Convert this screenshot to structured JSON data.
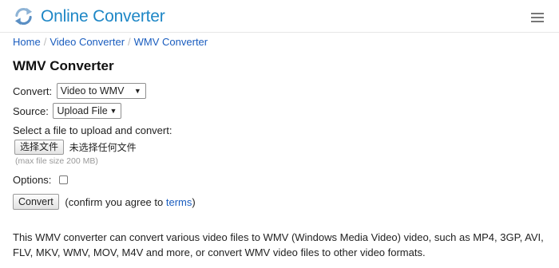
{
  "header": {
    "brand": "Online Converter",
    "logo_icon": "refresh-arrows-icon",
    "menu_icon": "hamburger-menu-icon",
    "brand_color": "#1e87c6"
  },
  "breadcrumb": {
    "items": [
      "Home",
      "Video Converter",
      "WMV Converter"
    ],
    "separator": "/"
  },
  "page_title": "WMV Converter",
  "form": {
    "convert_label": "Convert:",
    "convert_value": "Video to WMV",
    "source_label": "Source:",
    "source_value": "Upload File",
    "select_prompt": "Select a file to upload and convert:",
    "choose_file_button": "选择文件",
    "file_status": "未选择任何文件",
    "max_size_hint": "(max file size 200 MB)",
    "options_label": "Options:",
    "options_checked": false,
    "convert_button": "Convert",
    "confirm_prefix": "(confirm you agree to ",
    "terms_link": "terms",
    "confirm_suffix": ")"
  },
  "description": "This WMV converter can convert various video files to WMV (Windows Media Video) video, such as MP4, 3GP, AVI, FLV, MKV, WMV, MOV, M4V and more, or convert WMV video files to other video formats."
}
